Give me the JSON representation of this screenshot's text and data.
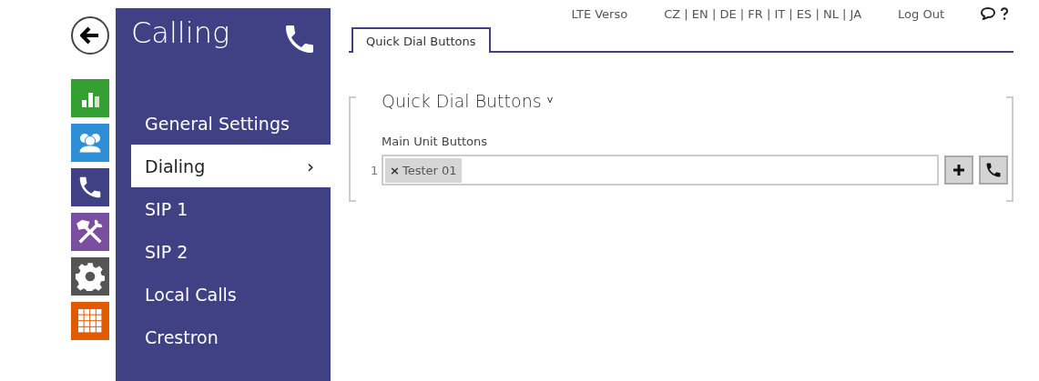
{
  "header": {
    "device": "LTE Verso",
    "languages": "CZ | EN | DE | FR | IT | ES | NL | JA",
    "logout": "Log Out"
  },
  "app_bar": [
    {
      "kind": "stats",
      "color": "#34a033"
    },
    {
      "kind": "directory",
      "color": "#2e8fd6"
    },
    {
      "kind": "calling",
      "color": "#404084"
    },
    {
      "kind": "hardware",
      "color": "#7b4fa0"
    },
    {
      "kind": "system",
      "color": "#555555"
    },
    {
      "kind": "services",
      "color": "#e05a00"
    }
  ],
  "sidebar": {
    "title": "Calling",
    "items": [
      {
        "label": "General Settings",
        "selected": false
      },
      {
        "label": "Dialing",
        "selected": true,
        "chevron": "›"
      },
      {
        "label": "SIP 1",
        "selected": false
      },
      {
        "label": "SIP 2",
        "selected": false
      },
      {
        "label": "Local Calls",
        "selected": false
      },
      {
        "label": "Crestron",
        "selected": false
      }
    ]
  },
  "tabs": [
    {
      "label": "Quick Dial Buttons",
      "selected": true
    }
  ],
  "section": {
    "title": "Quick Dial Buttons",
    "caret": "˅",
    "expanded": true,
    "field_label": "Main Unit Buttons",
    "rows": [
      {
        "index": "1",
        "tags": [
          {
            "remove": "×",
            "label": "Tester 01"
          }
        ]
      }
    ]
  }
}
